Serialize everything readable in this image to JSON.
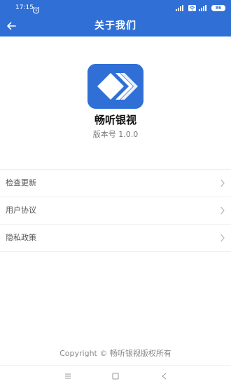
{
  "status_bar": {
    "time": "17:15",
    "battery": "86",
    "icons": [
      "alarm-icon",
      "signal-icon",
      "wifi-icon",
      "signal-icon",
      "battery-icon"
    ]
  },
  "header": {
    "title": "关于我们",
    "back_icon": "arrow-left-icon",
    "background_color": "#2f6fd6"
  },
  "app": {
    "name": "畅听银视",
    "version": "版本号 1.0.0",
    "logo_icon": "app-logo",
    "logo_color": "#2f6fd6"
  },
  "menu": {
    "items": [
      {
        "label": "检查更新",
        "icon": "chevron-right-icon"
      },
      {
        "label": "用户协议",
        "icon": "chevron-right-icon"
      },
      {
        "label": "隐私政策",
        "icon": "chevron-right-icon"
      }
    ]
  },
  "footer": {
    "copyright": "Copyright © 畅听银视版权所有"
  },
  "nav_bar": {
    "buttons": [
      "menu-icon",
      "home-square-icon",
      "back-triangle-icon"
    ]
  }
}
